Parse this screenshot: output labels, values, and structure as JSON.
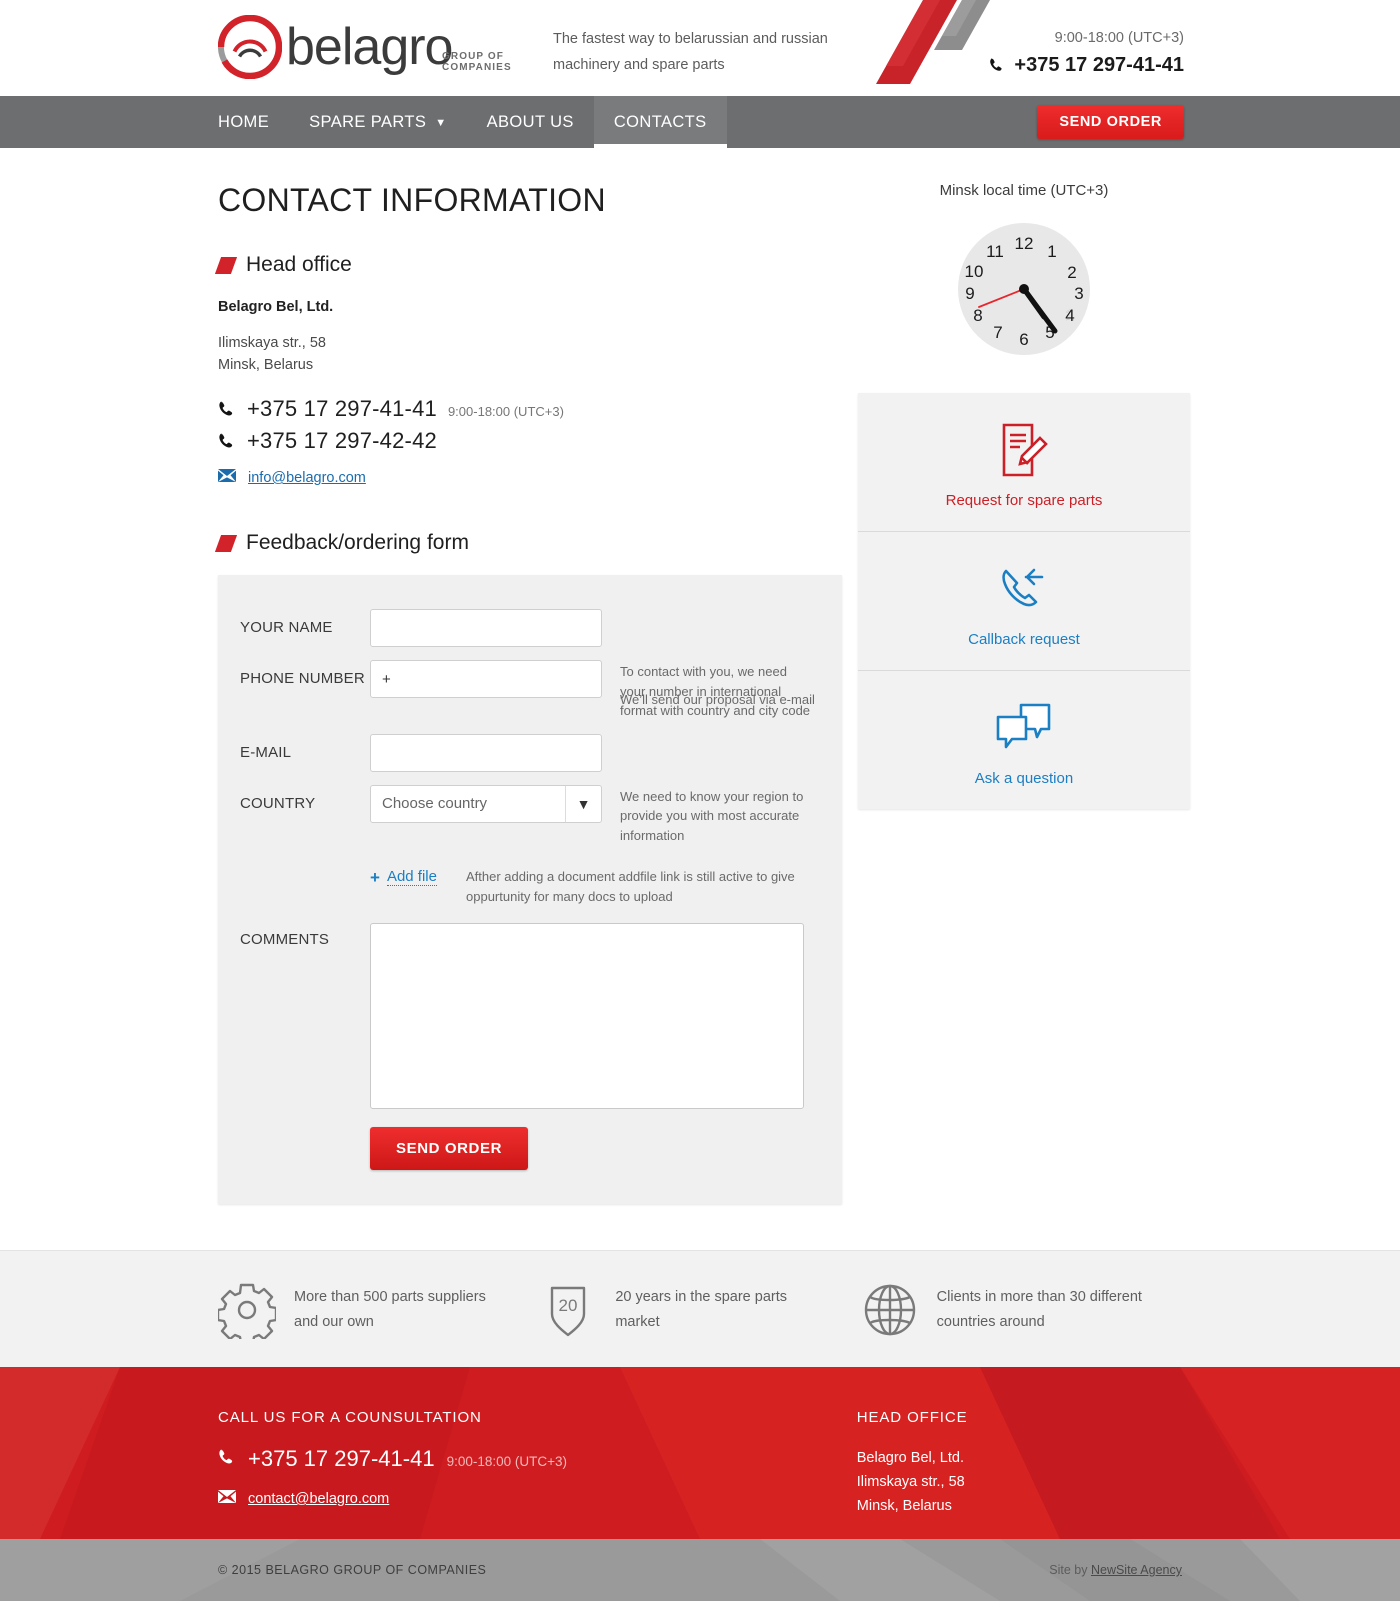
{
  "header": {
    "logo_text": "belagro",
    "logo_sub": "GROUP OF COMPANIES",
    "tagline": "The fastest way to belarussian and russian machinery and spare parts",
    "hours": "9:00-18:00 (UTC+3)",
    "phone": "+375 17 297-41-41"
  },
  "nav": {
    "items": [
      {
        "label": "HOME",
        "active": false,
        "has_caret": false
      },
      {
        "label": "SPARE PARTS",
        "active": false,
        "has_caret": true
      },
      {
        "label": "ABOUT US",
        "active": false,
        "has_caret": false
      },
      {
        "label": "CONTACTS",
        "active": true,
        "has_caret": false
      }
    ],
    "send_order_label": "SEND ORDER"
  },
  "main": {
    "page_title": "CONTACT INFORMATION",
    "head_office": {
      "section_title": "Head office",
      "company": "Belagro Bel, Ltd.",
      "street": "Ilimskaya str., 58",
      "city": "Minsk, Belarus",
      "phone1": "+375 17 297-41-41",
      "phone1_hours": "9:00-18:00 (UTC+3)",
      "phone2": "+375 17 297-42-42",
      "email": "info@belagro.com"
    },
    "form": {
      "section_title": "Feedback/ordering form",
      "name_label": "YOUR NAME",
      "name_value": "",
      "name_placeholder": "",
      "phone_label": "PHONE NUMBER",
      "phone_value": "+",
      "phone_placeholder": "+",
      "phone_hint": "To contact with you, we need your number in international format with country and city code",
      "email_label": "E-MAIL",
      "email_value": "",
      "email_placeholder": "",
      "email_hint": "We’ll send our proposal via e-mail",
      "country_label": "COUNTRY",
      "country_selected": "Choose country",
      "country_hint": "We need to know your region to provide you with most accurate information",
      "addfile_label": "Add file",
      "addfile_plus": "+",
      "addfile_hint": "Afther adding a document addfile link is still active to give oppurtunity for many docs to upload",
      "comments_label": "COMMENTS",
      "comments_value": "",
      "submit_label": "SEND ORDER"
    }
  },
  "sidebar": {
    "clock_title": "Minsk local time (UTC+3)",
    "clock": {
      "hour": 4,
      "minute": 20,
      "second": 41,
      "numerals": [
        "12",
        "1",
        "2",
        "3",
        "4",
        "5",
        "6",
        "7",
        "8",
        "9",
        "10",
        "11"
      ],
      "hand_color_second": "#e8262c",
      "hand_color_hour": "#111111"
    },
    "cards": [
      {
        "label": "Request for spare parts",
        "icon": "document-pencil-icon",
        "color": "#cb2027"
      },
      {
        "label": "Callback request",
        "icon": "phone-callback-icon",
        "color": "#1b7fc4"
      },
      {
        "label": "Ask a question",
        "icon": "chat-bubbles-icon",
        "color": "#1b7fc4"
      }
    ]
  },
  "features": [
    {
      "icon": "gear-icon",
      "text": "More than 500 parts suppliers and our own"
    },
    {
      "icon": "shield-20-icon",
      "text": "20 years in the spare parts market",
      "badge": "20"
    },
    {
      "icon": "globe-icon",
      "text": "Clients in more than 30 different countries around"
    }
  ],
  "footer": {
    "call_title": "CALL US FOR A COUNSULTATION",
    "phone": "+375 17 297-41-41",
    "hours": "9:00-18:00 (UTC+3)",
    "email": "contact@belagro.com",
    "office_title": "HEAD OFFICE",
    "office_company": "Belagro Bel, Ltd.",
    "office_street": "Ilimskaya str., 58",
    "office_city": "Minsk, Belarus",
    "copyright": "© 2015 BELAGRO GROUP OF COMPANIES",
    "byline_prefix": "Site by ",
    "byline_link": "NewSite Agency"
  },
  "colors": {
    "brand_red": "#d2232a",
    "footer_red": "#cf1c20",
    "nav_grey": "#6d6e70",
    "link_blue": "#1b7fc4"
  }
}
